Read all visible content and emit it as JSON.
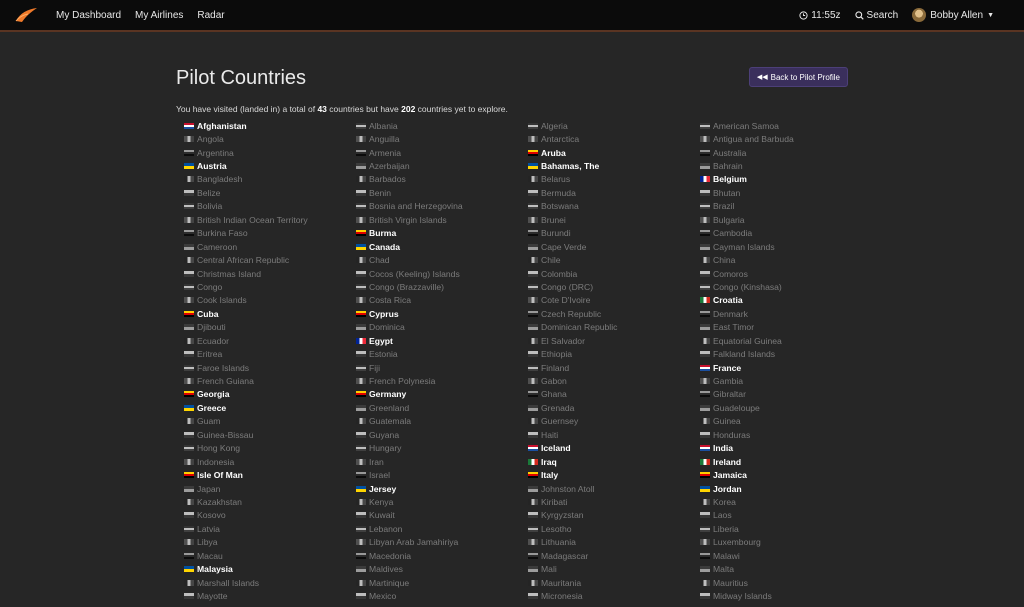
{
  "nav": {
    "links": [
      "My Dashboard",
      "My Airlines",
      "Radar"
    ],
    "time": "11:55z",
    "search": "Search",
    "user": "Bobby Allen"
  },
  "page": {
    "title": "Pilot Countries",
    "back_button": "Back to Pilot Profile",
    "summary": {
      "prefix": "You have visited (landed in) a total of ",
      "visited_count": "43",
      "middle": " countries but have ",
      "remaining_count": "202",
      "suffix": " countries yet to explore."
    }
  },
  "countries": [
    [
      {
        "name": "Afghanistan",
        "visited": true
      },
      {
        "name": "Angola",
        "visited": false
      },
      {
        "name": "Argentina",
        "visited": false
      },
      {
        "name": "Austria",
        "visited": true
      },
      {
        "name": "Bangladesh",
        "visited": false
      },
      {
        "name": "Belize",
        "visited": false
      },
      {
        "name": "Bolivia",
        "visited": false
      },
      {
        "name": "British Indian Ocean Territory",
        "visited": false
      },
      {
        "name": "Burkina Faso",
        "visited": false
      },
      {
        "name": "Cameroon",
        "visited": false
      },
      {
        "name": "Central African Republic",
        "visited": false
      },
      {
        "name": "Christmas Island",
        "visited": false
      },
      {
        "name": "Congo",
        "visited": false
      },
      {
        "name": "Cook Islands",
        "visited": false
      },
      {
        "name": "Cuba",
        "visited": true
      },
      {
        "name": "Djibouti",
        "visited": false
      },
      {
        "name": "Ecuador",
        "visited": false
      },
      {
        "name": "Eritrea",
        "visited": false
      },
      {
        "name": "Faroe Islands",
        "visited": false
      },
      {
        "name": "French Guiana",
        "visited": false
      },
      {
        "name": "Georgia",
        "visited": true
      },
      {
        "name": "Greece",
        "visited": true
      },
      {
        "name": "Guam",
        "visited": false
      },
      {
        "name": "Guinea-Bissau",
        "visited": false
      },
      {
        "name": "Hong Kong",
        "visited": false
      },
      {
        "name": "Indonesia",
        "visited": false
      },
      {
        "name": "Isle Of Man",
        "visited": true
      },
      {
        "name": "Japan",
        "visited": false
      },
      {
        "name": "Kazakhstan",
        "visited": false
      },
      {
        "name": "Kosovo",
        "visited": false
      },
      {
        "name": "Latvia",
        "visited": false
      },
      {
        "name": "Libya",
        "visited": false
      },
      {
        "name": "Macau",
        "visited": false
      },
      {
        "name": "Malaysia",
        "visited": true
      },
      {
        "name": "Marshall Islands",
        "visited": false
      },
      {
        "name": "Mayotte",
        "visited": false
      }
    ],
    [
      {
        "name": "Albania",
        "visited": false
      },
      {
        "name": "Anguilla",
        "visited": false
      },
      {
        "name": "Armenia",
        "visited": false
      },
      {
        "name": "Azerbaijan",
        "visited": false
      },
      {
        "name": "Barbados",
        "visited": false
      },
      {
        "name": "Benin",
        "visited": false
      },
      {
        "name": "Bosnia and Herzegovina",
        "visited": false
      },
      {
        "name": "British Virgin Islands",
        "visited": false
      },
      {
        "name": "Burma",
        "visited": true
      },
      {
        "name": "Canada",
        "visited": true
      },
      {
        "name": "Chad",
        "visited": false
      },
      {
        "name": "Cocos (Keeling) Islands",
        "visited": false
      },
      {
        "name": "Congo (Brazzaville)",
        "visited": false
      },
      {
        "name": "Costa Rica",
        "visited": false
      },
      {
        "name": "Cyprus",
        "visited": true
      },
      {
        "name": "Dominica",
        "visited": false
      },
      {
        "name": "Egypt",
        "visited": true
      },
      {
        "name": "Estonia",
        "visited": false
      },
      {
        "name": "Fiji",
        "visited": false
      },
      {
        "name": "French Polynesia",
        "visited": false
      },
      {
        "name": "Germany",
        "visited": true
      },
      {
        "name": "Greenland",
        "visited": false
      },
      {
        "name": "Guatemala",
        "visited": false
      },
      {
        "name": "Guyana",
        "visited": false
      },
      {
        "name": "Hungary",
        "visited": false
      },
      {
        "name": "Iran",
        "visited": false
      },
      {
        "name": "Israel",
        "visited": false
      },
      {
        "name": "Jersey",
        "visited": true
      },
      {
        "name": "Kenya",
        "visited": false
      },
      {
        "name": "Kuwait",
        "visited": false
      },
      {
        "name": "Lebanon",
        "visited": false
      },
      {
        "name": "Libyan Arab Jamahiriya",
        "visited": false
      },
      {
        "name": "Macedonia",
        "visited": false
      },
      {
        "name": "Maldives",
        "visited": false
      },
      {
        "name": "Martinique",
        "visited": false
      },
      {
        "name": "Mexico",
        "visited": false
      }
    ],
    [
      {
        "name": "Algeria",
        "visited": false
      },
      {
        "name": "Antarctica",
        "visited": false
      },
      {
        "name": "Aruba",
        "visited": true
      },
      {
        "name": "Bahamas, The",
        "visited": true
      },
      {
        "name": "Belarus",
        "visited": false
      },
      {
        "name": "Bermuda",
        "visited": false
      },
      {
        "name": "Botswana",
        "visited": false
      },
      {
        "name": "Brunei",
        "visited": false
      },
      {
        "name": "Burundi",
        "visited": false
      },
      {
        "name": "Cape Verde",
        "visited": false
      },
      {
        "name": "Chile",
        "visited": false
      },
      {
        "name": "Colombia",
        "visited": false
      },
      {
        "name": "Congo (DRC)",
        "visited": false
      },
      {
        "name": "Cote D'Ivoire",
        "visited": false
      },
      {
        "name": "Czech Republic",
        "visited": false
      },
      {
        "name": "Dominican Republic",
        "visited": false
      },
      {
        "name": "El Salvador",
        "visited": false
      },
      {
        "name": "Ethiopia",
        "visited": false
      },
      {
        "name": "Finland",
        "visited": false
      },
      {
        "name": "Gabon",
        "visited": false
      },
      {
        "name": "Ghana",
        "visited": false
      },
      {
        "name": "Grenada",
        "visited": false
      },
      {
        "name": "Guernsey",
        "visited": false
      },
      {
        "name": "Haiti",
        "visited": false
      },
      {
        "name": "Iceland",
        "visited": true
      },
      {
        "name": "Iraq",
        "visited": true
      },
      {
        "name": "Italy",
        "visited": true
      },
      {
        "name": "Johnston Atoll",
        "visited": false
      },
      {
        "name": "Kiribati",
        "visited": false
      },
      {
        "name": "Kyrgyzstan",
        "visited": false
      },
      {
        "name": "Lesotho",
        "visited": false
      },
      {
        "name": "Lithuania",
        "visited": false
      },
      {
        "name": "Madagascar",
        "visited": false
      },
      {
        "name": "Mali",
        "visited": false
      },
      {
        "name": "Mauritania",
        "visited": false
      },
      {
        "name": "Micronesia",
        "visited": false
      }
    ],
    [
      {
        "name": "American Samoa",
        "visited": false
      },
      {
        "name": "Antigua and Barbuda",
        "visited": false
      },
      {
        "name": "Australia",
        "visited": false
      },
      {
        "name": "Bahrain",
        "visited": false
      },
      {
        "name": "Belgium",
        "visited": true
      },
      {
        "name": "Bhutan",
        "visited": false
      },
      {
        "name": "Brazil",
        "visited": false
      },
      {
        "name": "Bulgaria",
        "visited": false
      },
      {
        "name": "Cambodia",
        "visited": false
      },
      {
        "name": "Cayman Islands",
        "visited": false
      },
      {
        "name": "China",
        "visited": false
      },
      {
        "name": "Comoros",
        "visited": false
      },
      {
        "name": "Congo (Kinshasa)",
        "visited": false
      },
      {
        "name": "Croatia",
        "visited": true
      },
      {
        "name": "Denmark",
        "visited": false
      },
      {
        "name": "East Timor",
        "visited": false
      },
      {
        "name": "Equatorial Guinea",
        "visited": false
      },
      {
        "name": "Falkland Islands",
        "visited": false
      },
      {
        "name": "France",
        "visited": true
      },
      {
        "name": "Gambia",
        "visited": false
      },
      {
        "name": "Gibraltar",
        "visited": false
      },
      {
        "name": "Guadeloupe",
        "visited": false
      },
      {
        "name": "Guinea",
        "visited": false
      },
      {
        "name": "Honduras",
        "visited": false
      },
      {
        "name": "India",
        "visited": true
      },
      {
        "name": "Ireland",
        "visited": true
      },
      {
        "name": "Jamaica",
        "visited": true
      },
      {
        "name": "Jordan",
        "visited": true
      },
      {
        "name": "Korea",
        "visited": false
      },
      {
        "name": "Laos",
        "visited": false
      },
      {
        "name": "Liberia",
        "visited": false
      },
      {
        "name": "Luxembourg",
        "visited": false
      },
      {
        "name": "Malawi",
        "visited": false
      },
      {
        "name": "Malta",
        "visited": false
      },
      {
        "name": "Mauritius",
        "visited": false
      },
      {
        "name": "Midway Islands",
        "visited": false
      }
    ]
  ]
}
